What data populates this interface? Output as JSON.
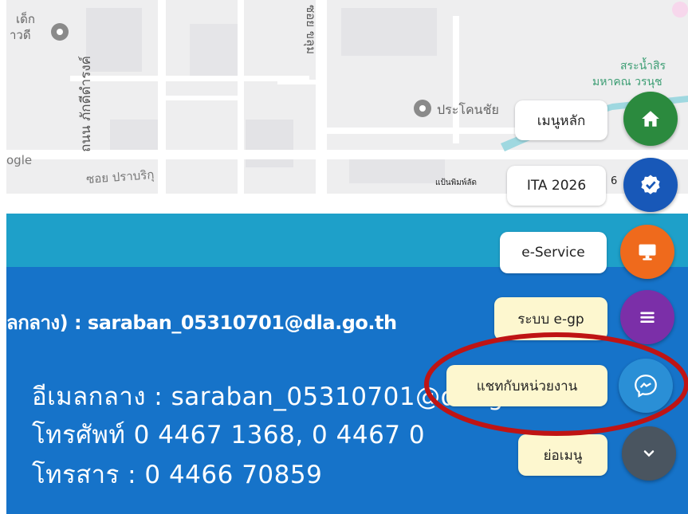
{
  "map": {
    "labels": {
      "kids_top": "เด็ก",
      "kids_sub": "าวดี",
      "street_vertical": "ถนน ภักดีดำรงค์",
      "soi_top": "ซอย ขลุม",
      "poi": "ประโคนชัย",
      "green_top": "สระน้ำสิร",
      "green_sub": "มหาคณ วรนุช",
      "google": "ogle",
      "soi_bottom": "ซอย ปราบริกุ",
      "shortcut": "แป้นพิมพ์ลัด",
      "digit": "6"
    },
    "colors": {
      "green": "#3d9e74",
      "road": "#ffffff"
    }
  },
  "contact": {
    "line1": "ลกลาง) : saraban_05310701@dla.go.th",
    "line2": "อีเมลกลาง : saraban_05310701@dla.go.th",
    "line3": "โทรศัพท์ 0 4467 1368, 0 4467 0",
    "line4": "โทรสาร : 0 4466 70859"
  },
  "menu": {
    "items": [
      {
        "label": "เมนูหลัก",
        "icon": "home-icon",
        "color": "#2b8a3e"
      },
      {
        "label": "ITA 2026",
        "icon": "badge-check-icon",
        "color": "#1858b8"
      },
      {
        "label": "e-Service",
        "icon": "monitor-icon",
        "color": "#ef6a1c"
      },
      {
        "label": "ระบบ e-gp",
        "icon": "list-icon",
        "color": "#7b2fa8"
      },
      {
        "label": "แชทกับหน่วยงาน",
        "icon": "messenger-icon",
        "color": "#2a8fd6"
      },
      {
        "label": "ย่อเมนู",
        "icon": "chevron-down-icon",
        "color": "#4a5560"
      }
    ]
  },
  "annotation": {
    "color": "#bf1414"
  }
}
